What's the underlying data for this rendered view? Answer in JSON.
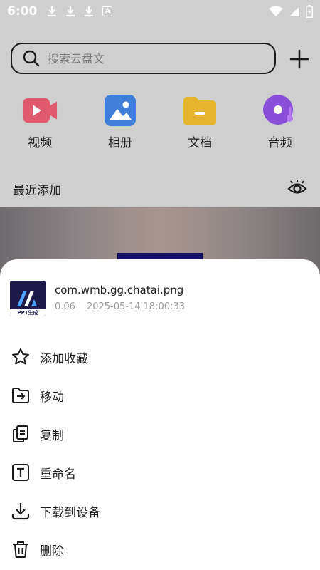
{
  "status_bar": {
    "time": "6:00",
    "a_badge": "A"
  },
  "search": {
    "placeholder": "搜索云盘文"
  },
  "categories": [
    {
      "label": "视频",
      "icon": "video-icon",
      "color": "#e05a6e"
    },
    {
      "label": "相册",
      "icon": "photo-album-icon",
      "color": "#3f7fd9"
    },
    {
      "label": "文档",
      "icon": "document-folder-icon",
      "color": "#e6b52e"
    },
    {
      "label": "音频",
      "icon": "audio-disc-icon",
      "color": "#8a4fd8"
    }
  ],
  "recent": {
    "title": "最近添加"
  },
  "file": {
    "thumb_text": "PPT生成",
    "name": "com.wmb.gg.chatai.png",
    "size": "0.06",
    "date": "2025-05-14 18:00:33"
  },
  "actions": [
    {
      "label": "添加收藏",
      "icon": "star-icon"
    },
    {
      "label": "移动",
      "icon": "move-folder-icon"
    },
    {
      "label": "复制",
      "icon": "copy-icon"
    },
    {
      "label": "重命名",
      "icon": "rename-icon"
    },
    {
      "label": "下载到设备",
      "icon": "download-icon"
    },
    {
      "label": "删除",
      "icon": "trash-icon"
    }
  ]
}
